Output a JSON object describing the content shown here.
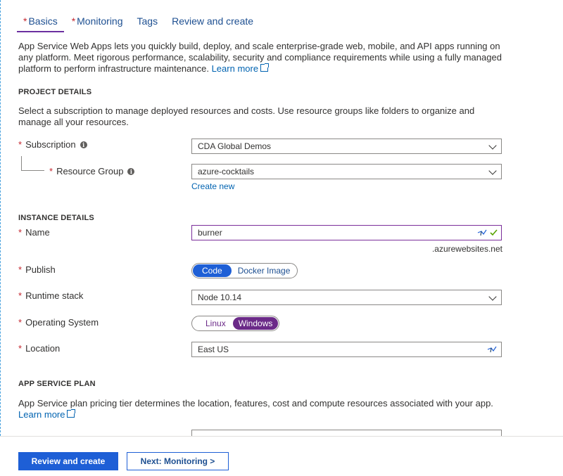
{
  "tabs": [
    {
      "label": "Basics",
      "required": true,
      "active": true
    },
    {
      "label": "Monitoring",
      "required": true,
      "active": false
    },
    {
      "label": "Tags",
      "required": false,
      "active": false
    },
    {
      "label": "Review and create",
      "required": false,
      "active": false
    }
  ],
  "intro": {
    "text": "App Service Web Apps lets you quickly build, deploy, and scale enterprise-grade web, mobile, and API apps running on any platform. Meet rigorous performance, scalability, security and compliance requirements while using a fully managed platform to perform infrastructure maintenance.",
    "link": "Learn more"
  },
  "project_details": {
    "title": "PROJECT DETAILS",
    "description": "Select a subscription to manage deployed resources and costs. Use resource groups like folders to organize and manage all your resources.",
    "subscription_label": "Subscription",
    "subscription_value": "CDA Global Demos",
    "resource_group_label": "Resource Group",
    "resource_group_value": "azure-cocktails",
    "create_new": "Create new"
  },
  "instance_details": {
    "title": "INSTANCE DETAILS",
    "name_label": "Name",
    "name_value": "burner",
    "name_suffix": ".azurewebsites.net",
    "publish_label": "Publish",
    "publish_options": [
      "Code",
      "Docker Image"
    ],
    "publish_selected": "Code",
    "runtime_label": "Runtime stack",
    "runtime_value": "Node 10.14",
    "os_label": "Operating System",
    "os_options": [
      "Linux",
      "Windows"
    ],
    "os_selected": "Windows",
    "location_label": "Location",
    "location_value": "East US"
  },
  "app_service_plan": {
    "title": "APP SERVICE PLAN",
    "description": "App Service plan pricing tier determines the location, features, cost and compute resources associated with your app.",
    "link": "Learn more"
  },
  "footer": {
    "review_button": "Review and create",
    "next_button": "Next: Monitoring >"
  },
  "colors": {
    "primary": "#1e5fd6",
    "code_selected": "#1e5fd6",
    "windows_selected": "#6b2a88",
    "required": "#c4262e",
    "focus_border": "#7a2e9a",
    "link": "#0063b1"
  }
}
